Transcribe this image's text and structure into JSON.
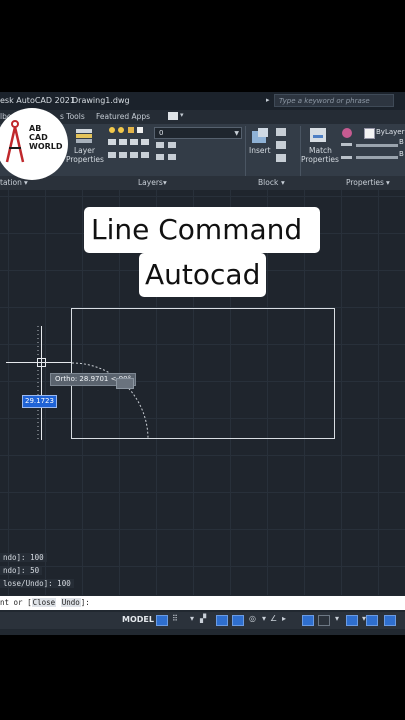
{
  "titlebar": {
    "app_title": "esk AutoCAD 2021",
    "doc_title": "Drawing1.dwg",
    "search_placeholder": "Type a keyword or phrase"
  },
  "tabs": {
    "tab_partial_left": "lbo",
    "tab_tools": "s Tools",
    "tab_featured": "Featured Apps"
  },
  "logo": {
    "line1": "AB",
    "line2": "CAD",
    "line3": "WORLD"
  },
  "ribbon": {
    "layer_props_label_1": "Layer",
    "layer_props_label_2": "Properties",
    "layer_combo_value": "0",
    "insert_label": "Insert",
    "match_label_1": "Match",
    "match_label_2": "Properties",
    "bylayer_label": "ByLayer",
    "prop_line_value_1": "B",
    "prop_line_value_2": "B",
    "partial_label": "able",
    "foot_annotation": "tation",
    "foot_layers": "Layers",
    "foot_block": "Block",
    "foot_properties": "Properties"
  },
  "overlay": {
    "title_line1": "Line Command",
    "title_line2": "Autocad"
  },
  "drawing": {
    "tooltip_text": "Ortho: 28.9701 < 90°",
    "dynamic_input_value": "29.1723"
  },
  "command": {
    "history_1": "ndo]: 100",
    "history_2": "ndo]: 50",
    "history_3": "lose/Undo]: 100",
    "prompt_prefix": "nt or [",
    "option_close": "Close",
    "option_undo": "Undo",
    "prompt_suffix": "]:"
  },
  "status": {
    "model_label": "MODEL"
  },
  "colors": {
    "canvas_bg": "#1f252d",
    "ribbon_bg": "#333c47",
    "accent_blue": "#2f6fcf"
  }
}
